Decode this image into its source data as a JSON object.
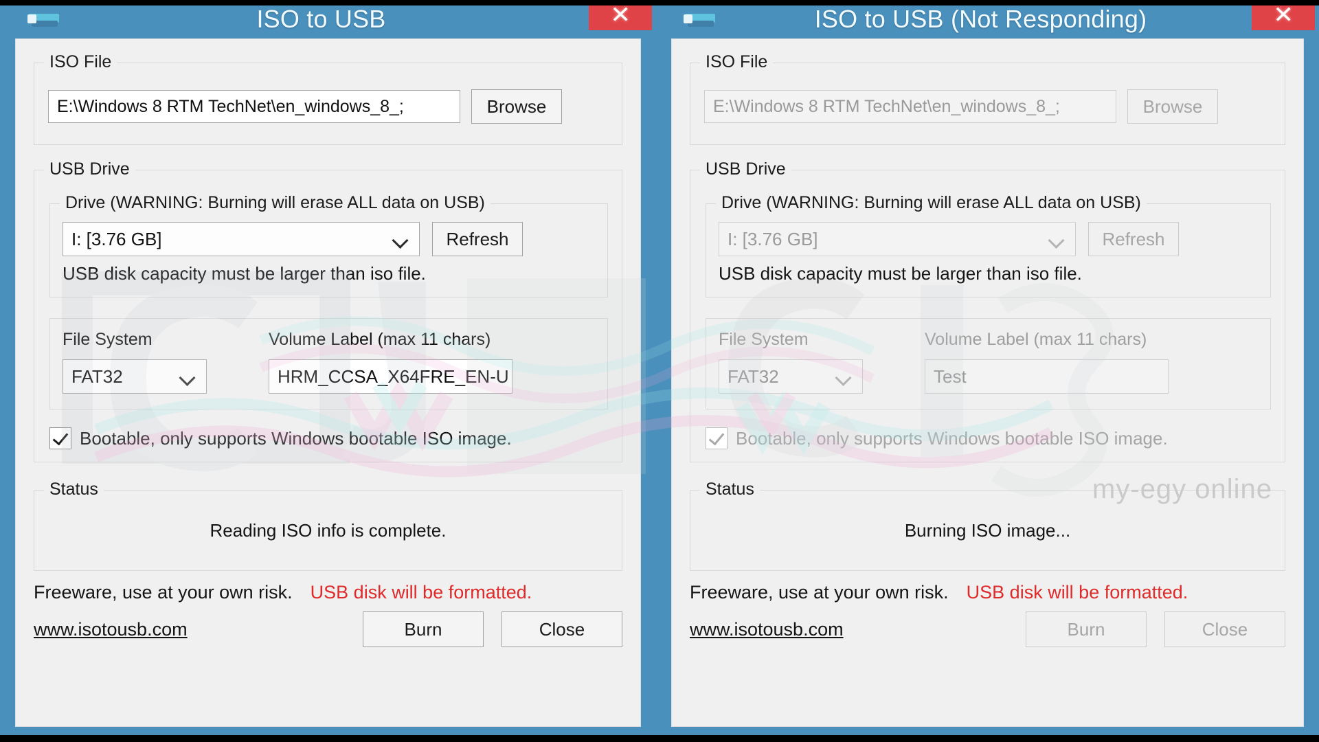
{
  "windows": [
    {
      "id": "left",
      "title": "ISO to USB",
      "close_label": "✕",
      "iso_group": {
        "legend": "ISO File",
        "path_value": "E:\\Windows 8 RTM TechNet\\en_windows_8_;",
        "browse_label": "Browse"
      },
      "usb_group": {
        "legend": "USB Drive",
        "drive_legend": "Drive (WARNING: Burning will erase ALL data on USB)",
        "drive_value": "I: [3.76 GB]",
        "refresh_label": "Refresh",
        "capacity_hint": "USB disk capacity must be larger than iso file.",
        "filesystem_label": "File System",
        "filesystem_value": "FAT32",
        "volume_label": "Volume Label (max 11 chars)",
        "volume_value": "HRM_CCSA_X64FRE_EN-U",
        "bootable_label": "Bootable, only supports Windows bootable ISO image."
      },
      "status_group": {
        "legend": "Status",
        "message": "Reading ISO info is complete."
      },
      "footer": {
        "risk_text": "Freeware, use at your own risk.",
        "warn_text": "USB disk will be formatted.",
        "site_link": "www.isotousb.com",
        "burn_label": "Burn",
        "close_label": "Close"
      }
    },
    {
      "id": "right",
      "title": "ISO to USB (Not Responding)",
      "close_label": "✕",
      "iso_group": {
        "legend": "ISO File",
        "path_value": "E:\\Windows 8 RTM TechNet\\en_windows_8_;",
        "browse_label": "Browse"
      },
      "usb_group": {
        "legend": "USB Drive",
        "drive_legend": "Drive (WARNING: Burning will erase ALL data on USB)",
        "drive_value": "I: [3.76 GB]",
        "refresh_label": "Refresh",
        "capacity_hint": "USB disk capacity must be larger than iso file.",
        "filesystem_label": "File System",
        "filesystem_value": "FAT32",
        "volume_label": "Volume Label (max 11 chars)",
        "volume_value": "Test",
        "bootable_label": "Bootable, only supports Windows bootable ISO image."
      },
      "status_group": {
        "legend": "Status",
        "message": "Burning ISO image..."
      },
      "footer": {
        "risk_text": "Freeware, use at your own risk.",
        "warn_text": "USB disk will be formatted.",
        "site_link": "www.isotousb.com",
        "burn_label": "Burn",
        "close_label": "Close"
      }
    }
  ],
  "watermark": {
    "text": "my-egy online"
  },
  "colors": {
    "titlebar": "#4a90bd",
    "close_button": "#e04347",
    "warning_red": "#e02a2a",
    "client_background": "#f0f0f0"
  }
}
